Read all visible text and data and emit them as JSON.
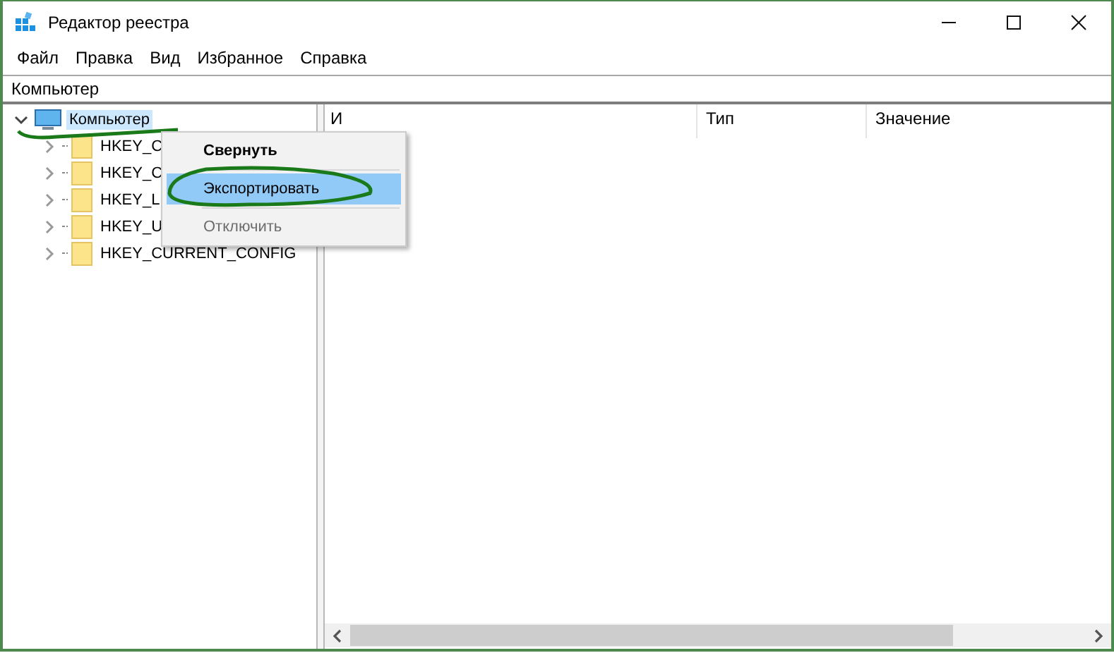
{
  "window": {
    "title": "Редактор реестра",
    "controls": [
      {
        "kind": "minimize"
      },
      {
        "kind": "maximize"
      },
      {
        "kind": "close"
      }
    ]
  },
  "menu_bar": [
    "Файл",
    "Правка",
    "Вид",
    "Избранное",
    "Справка"
  ],
  "address_bar": {
    "value": "Компьютер"
  },
  "tree": [
    {
      "label": "Компьютер",
      "expanded": true,
      "selected": true,
      "children": [
        {
          "label": "HKEY_C",
          "expanded": false,
          "selected": false
        },
        {
          "label": "HKEY_C",
          "expanded": false,
          "selected": false
        },
        {
          "label": "HKEY_L",
          "expanded": false,
          "selected": false
        },
        {
          "label": "HKEY_U",
          "expanded": false,
          "selected": false
        },
        {
          "label": "HKEY_CURRENT_CONFIG",
          "expanded": false,
          "selected": false
        }
      ]
    }
  ],
  "table": {
    "columns": [
      "И",
      "Тип",
      "Значение"
    ]
  },
  "context_menu": [
    {
      "label": "Свернуть",
      "kind": "default",
      "selected": false,
      "disabled": false
    },
    {
      "label": "Экспортировать",
      "kind": "normal",
      "selected": true,
      "disabled": false
    },
    {
      "label": "Отключить",
      "kind": "normal",
      "selected": false,
      "disabled": true
    }
  ]
}
